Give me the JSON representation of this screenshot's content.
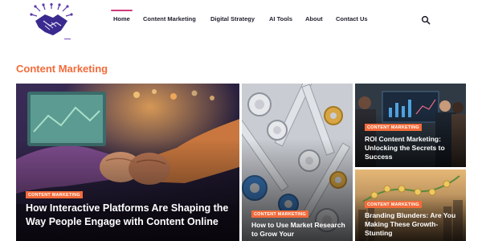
{
  "brand": {
    "logo_icon": "handshake-circuit-logo",
    "colors": {
      "accent": "#f26b3a",
      "nav_active": "#d13a7a",
      "logo": "#4b2a9b"
    }
  },
  "nav": {
    "items": [
      {
        "label": "Home",
        "active": true
      },
      {
        "label": "Content Marketing",
        "active": false
      },
      {
        "label": "Digital Strategy",
        "active": false
      },
      {
        "label": "AI Tools",
        "active": false
      },
      {
        "label": "About",
        "active": false
      },
      {
        "label": "Contact Us",
        "active": false
      }
    ],
    "search_icon": "search-icon"
  },
  "section": {
    "title": "Content Marketing"
  },
  "cards": [
    {
      "category": "CONTENT MARKETING",
      "title": "How Interactive Platforms Are Shaping the Way People Engage with Content Online"
    },
    {
      "category": "CONTENT MARKETING",
      "title": "How to Use Market Research to Grow Your"
    },
    {
      "category": "CONTENT MARKETING",
      "title": "ROI Content Marketing: Unlocking the Secrets to Success"
    },
    {
      "category": "CONTENT MARKETING",
      "title": "Branding Blunders: Are You Making These Growth-Stunting"
    }
  ]
}
